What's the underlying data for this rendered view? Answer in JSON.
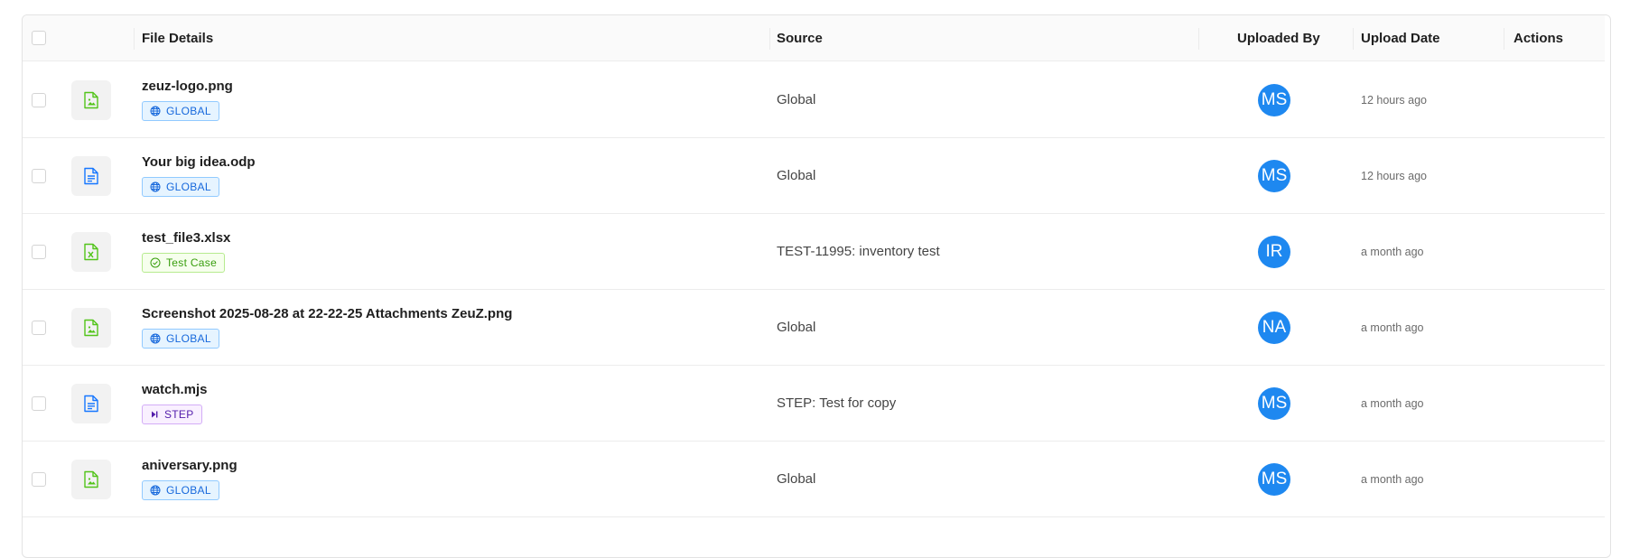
{
  "table": {
    "headers": {
      "file_details": "File Details",
      "source": "Source",
      "uploaded_by": "Uploaded By",
      "upload_date": "Upload Date",
      "actions": "Actions"
    },
    "rows": [
      {
        "filename": "zeuz-logo.png",
        "file_icon": "image-file-icon",
        "icon_color": "#52c41a",
        "tag": {
          "label": "GLOBAL",
          "kind": "global",
          "icon": "globe-icon"
        },
        "source": "Global",
        "uploader_initials": "MS",
        "date": "12 hours ago"
      },
      {
        "filename": "Your big idea.odp",
        "file_icon": "text-file-icon",
        "icon_color": "#1677ff",
        "tag": {
          "label": "GLOBAL",
          "kind": "global",
          "icon": "globe-icon"
        },
        "source": "Global",
        "uploader_initials": "MS",
        "date": "12 hours ago"
      },
      {
        "filename": "test_file3.xlsx",
        "file_icon": "spreadsheet-file-icon",
        "icon_color": "#52c41a",
        "tag": {
          "label": "Test Case",
          "kind": "testcase",
          "icon": "check-circle-icon"
        },
        "source": "TEST-11995: inventory test",
        "uploader_initials": "IR",
        "date": "a month ago"
      },
      {
        "filename": "Screenshot 2025-08-28 at 22-22-25 Attachments ZeuZ.png",
        "file_icon": "image-file-icon",
        "icon_color": "#52c41a",
        "tag": {
          "label": "GLOBAL",
          "kind": "global",
          "icon": "globe-icon"
        },
        "source": "Global",
        "uploader_initials": "NA",
        "date": "a month ago"
      },
      {
        "filename": "watch.mjs",
        "file_icon": "text-file-icon",
        "icon_color": "#1677ff",
        "tag": {
          "label": "STEP",
          "kind": "step",
          "icon": "step-forward-icon"
        },
        "source": "STEP: Test for copy",
        "uploader_initials": "MS",
        "date": "a month ago"
      },
      {
        "filename": "aniversary.png",
        "file_icon": "image-file-icon",
        "icon_color": "#52c41a",
        "tag": {
          "label": "GLOBAL",
          "kind": "global",
          "icon": "globe-icon"
        },
        "source": "Global",
        "uploader_initials": "MS",
        "date": "a month ago"
      }
    ]
  },
  "colors": {
    "avatar_bg": "#1e88f0",
    "global_tag": "#1668dc",
    "testcase_tag": "#389e0d",
    "step_tag": "#531dab"
  }
}
